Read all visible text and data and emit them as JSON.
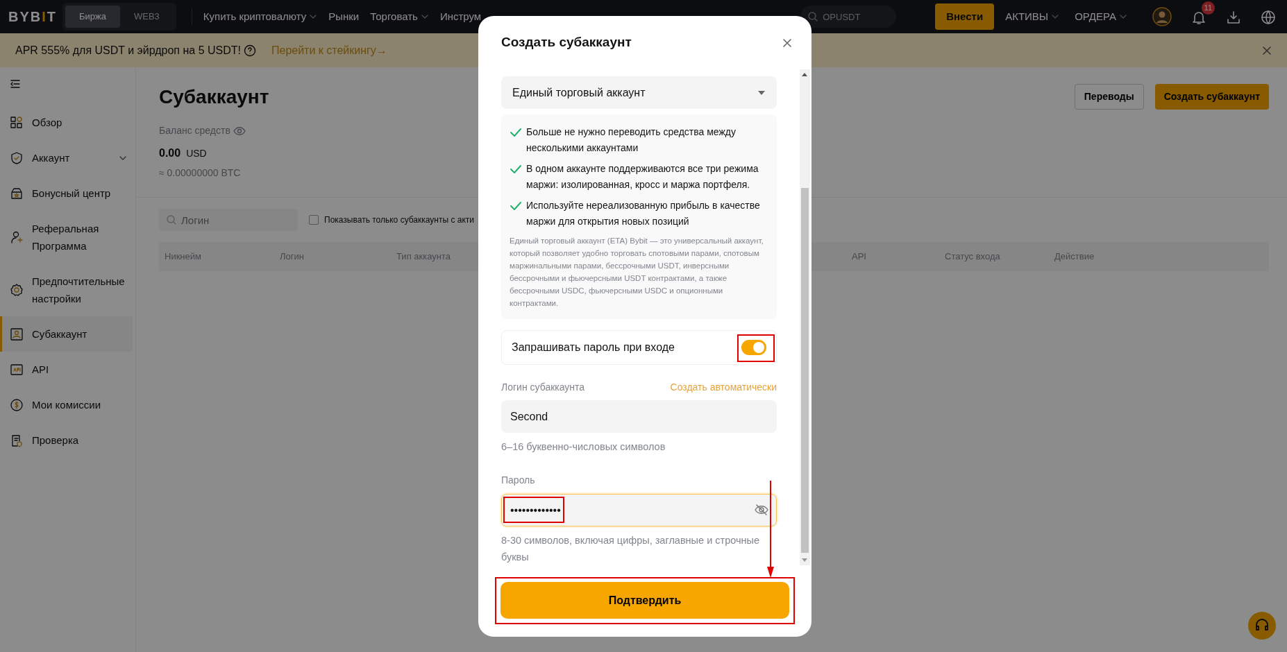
{
  "header": {
    "logo": "BYBIT",
    "mode_tabs": [
      {
        "label": "Биржа",
        "selected": true
      },
      {
        "label": "WEB3",
        "selected": false
      }
    ],
    "nav": [
      {
        "label": "Купить криптовалюту",
        "dropdown": true
      },
      {
        "label": "Рынки",
        "dropdown": false
      },
      {
        "label": "Торговать",
        "dropdown": true
      },
      {
        "label": "Инструм",
        "dropdown": false
      }
    ],
    "search": {
      "placeholder": "OPUSDT"
    },
    "deposit_button": "Внести",
    "menus": [
      "АКТИВЫ",
      "ОРДЕРА"
    ],
    "notifications": "11"
  },
  "banner": {
    "text": "APR 555% для USDT и эйрдроп на 5 USDT!",
    "link": "Перейти к стейкингу→"
  },
  "sidebar": {
    "items": [
      {
        "label": "Обзор",
        "selected": false,
        "submenu": false
      },
      {
        "label": "Аккаунт",
        "selected": false,
        "submenu": true
      },
      {
        "label": "Бонусный центр",
        "selected": false,
        "submenu": false
      },
      {
        "label": "Реферальная Программа",
        "selected": false,
        "submenu": false
      },
      {
        "label": "Предпочтительные настройки",
        "selected": false,
        "submenu": false
      },
      {
        "label": "Субаккаунт",
        "selected": true,
        "submenu": false
      },
      {
        "label": "API",
        "selected": false,
        "submenu": false
      },
      {
        "label": "Мои комиссии",
        "selected": false,
        "submenu": false
      },
      {
        "label": "Проверка",
        "selected": false,
        "submenu": false
      }
    ]
  },
  "page": {
    "title": "Субаккаунт",
    "balance_label": "Баланс средств",
    "balance": "0.00",
    "currency": "USD",
    "btc": "≈ 0.00000000 BTC",
    "buttons": [
      "Переводы",
      "Создать субаккаунт"
    ],
    "search": {
      "placeholder": "Логин"
    },
    "filter": {
      "label": "Показывать только субаккаунты с акти",
      "checked": false
    },
    "columns": [
      "Никнейм",
      "Логин",
      "Тип аккаунта",
      "API",
      "Статус входа",
      "Действие"
    ]
  },
  "modal": {
    "title": "Создать субаккаунт",
    "account_type": "Единый торговый аккаунт",
    "benefits": [
      "Больше не нужно переводить средства между несколькими аккаунтами",
      "В одном аккаунте поддерживаются все три режима маржи: изолированная, кросс и маржа портфеля.",
      "Используйте нереализованную прибыль в качестве маржи для открытия новых позиций"
    ],
    "description": "Единый торговый аккаунт (ETA) Bybit — это универсальный аккаунт, который позволяет удобно торговать спотовыми парами, спотовым маржинальными парами, бессрочными USDT, инверсными бессрочными и фьючерсными USDT контрактами, а также бессрочными USDC, фьючерсными USDC и опционными контрактами.",
    "ask_password": {
      "label": "Запрашивать пароль при входе",
      "on": true
    },
    "login": {
      "label": "Логин субаккаунта",
      "auto_link": "Создать автоматически",
      "value": "Second",
      "hint": "6–16 буквенно-числовых символов"
    },
    "password": {
      "label": "Пароль",
      "value": "•••••••••••••",
      "focused": true,
      "hint": "8-30 символов, включая цифры, заглавные и строчные буквы"
    },
    "submit": "Подтвердить"
  }
}
